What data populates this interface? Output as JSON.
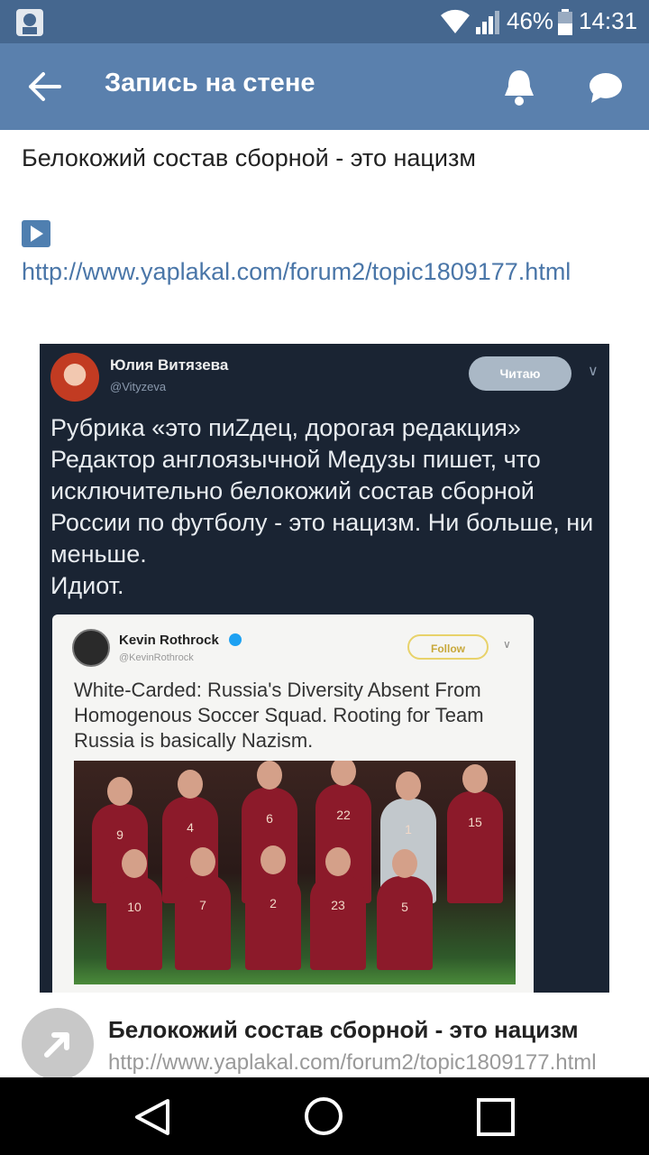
{
  "status_bar": {
    "battery": "46%",
    "time": "14:31"
  },
  "app_bar": {
    "title": "Запись на стене"
  },
  "post": {
    "text": "Белокожий состав сборной - это нацизм",
    "link": "http://www.yaplakal.com/forum2/topic1809177.html"
  },
  "tweet": {
    "name": "Юлия Витязева",
    "handle": "@Vityzeva",
    "follow_label": "Читаю",
    "body": "Рубрика «это пиZдец, дорогая редакция»\nРедактор англоязычной Медузы пишет, что исключительно белокожий состав сборной России по футболу - это нацизм. Ни больше, ни меньше.\nИдиот.",
    "quote": {
      "name": "Kevin Rothrock",
      "handle": "@KevinRothrock",
      "follow_label": "Follow",
      "body": "White-Carded: Russia's Diversity Absent From Homogenous Soccer Squad. Rooting for Team Russia is basically Nazism.",
      "jersey_numbers_back": [
        "9",
        "4",
        "6",
        "22",
        "1",
        "15"
      ],
      "jersey_numbers_front": [
        "10",
        "7",
        "2",
        "23",
        "5"
      ]
    }
  },
  "link_card": {
    "title": "Белокожий состав сборной - это нацизм",
    "url": "http://www.yaplakal.com/forum2/topic1809177.html"
  },
  "colors": {
    "status_bar": "#45678f",
    "app_bar": "#5a80ad",
    "link": "#4a76a8",
    "tweet_bg": "#1a2433"
  }
}
